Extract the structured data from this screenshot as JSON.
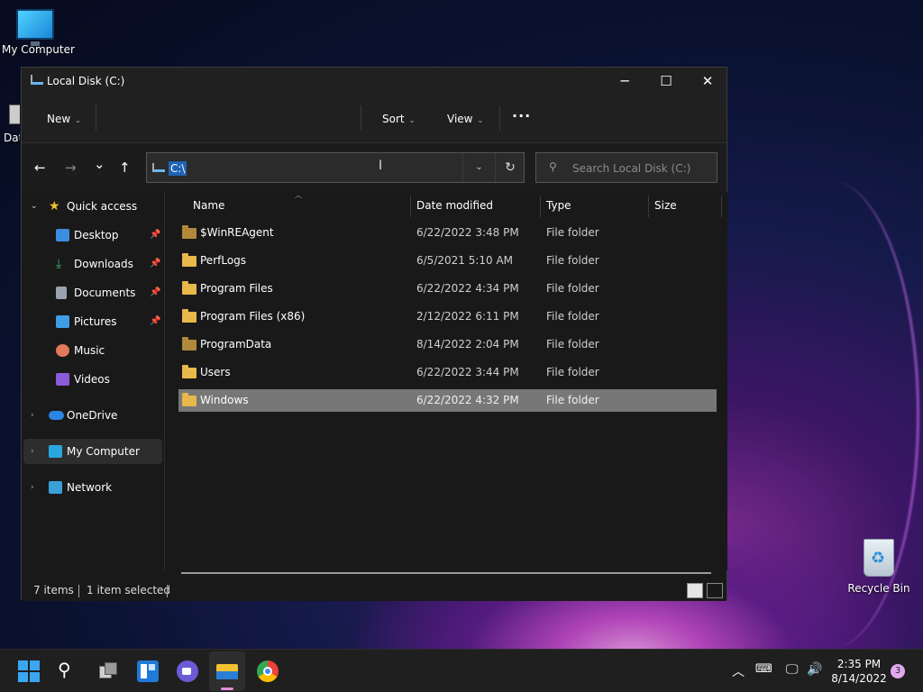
{
  "desktop": {
    "icons": [
      {
        "label": "My Computer",
        "icon": "computer-icon"
      },
      {
        "label": "Recycle Bin",
        "icon": "recycle-bin-icon"
      }
    ],
    "partial_icon_label": "Dat"
  },
  "window": {
    "title": "Local Disk (C:)",
    "controls": {
      "minimize": "─",
      "maximize": "☐",
      "close": "✕"
    }
  },
  "command_bar": {
    "new_label": "New",
    "sort_label": "Sort",
    "view_label": "View",
    "more_label": "···"
  },
  "navigation": {
    "back": "←",
    "forward": "→",
    "recent": "⌄",
    "up": "↑",
    "address_path": "C:\\",
    "refresh": "↻",
    "search_placeholder": "Search Local Disk (C:)"
  },
  "sidebar": {
    "items": [
      {
        "label": "Quick access",
        "icon": "star-icon",
        "color": "#f2c230"
      },
      {
        "label": "Desktop",
        "icon": "desktop-icon",
        "color": "#3b8de0",
        "pinned": true
      },
      {
        "label": "Downloads",
        "icon": "download-icon",
        "color": "#41b36b",
        "pinned": true
      },
      {
        "label": "Documents",
        "icon": "document-icon",
        "color": "#9aa3ad",
        "pinned": true
      },
      {
        "label": "Pictures",
        "icon": "picture-icon",
        "color": "#3f9de6",
        "pinned": true
      },
      {
        "label": "Music",
        "icon": "music-icon",
        "color": "#e07a5a"
      },
      {
        "label": "Videos",
        "icon": "video-icon",
        "color": "#8a5ad8"
      },
      {
        "label": "OneDrive",
        "icon": "cloud-icon",
        "color": "#2a86e0"
      },
      {
        "label": "My Computer",
        "icon": "computer-icon",
        "color": "#2aa7e0",
        "selected": true
      },
      {
        "label": "Network",
        "icon": "network-icon",
        "color": "#3aa0d8"
      }
    ]
  },
  "file_list": {
    "columns": [
      "Name",
      "Date modified",
      "Type",
      "Size"
    ],
    "rows": [
      {
        "name": "$WinREAgent",
        "date": "6/22/2022 3:48 PM",
        "type": "File folder",
        "hidden": true
      },
      {
        "name": "PerfLogs",
        "date": "6/5/2021 5:10 AM",
        "type": "File folder"
      },
      {
        "name": "Program Files",
        "date": "6/22/2022 4:34 PM",
        "type": "File folder"
      },
      {
        "name": "Program Files (x86)",
        "date": "2/12/2022 6:11 PM",
        "type": "File folder"
      },
      {
        "name": "ProgramData",
        "date": "8/14/2022 2:04 PM",
        "type": "File folder",
        "hidden": true
      },
      {
        "name": "Users",
        "date": "6/22/2022 3:44 PM",
        "type": "File folder"
      },
      {
        "name": "Windows",
        "date": "6/22/2022 4:32 PM",
        "type": "File folder",
        "selected": true
      }
    ]
  },
  "status_bar": {
    "item_count": "7 items",
    "selection": "1 item selected"
  },
  "taskbar": {
    "time": "2:35 PM",
    "date": "8/14/2022",
    "notification_count": "3",
    "apps": [
      "start-icon",
      "search-icon",
      "task-view-icon",
      "widgets-icon",
      "chat-icon",
      "file-explorer-icon",
      "chrome-icon"
    ]
  },
  "colors": {
    "accent": "#1f63b3",
    "selection_row": "#777777",
    "folder": "#e8b84a"
  }
}
